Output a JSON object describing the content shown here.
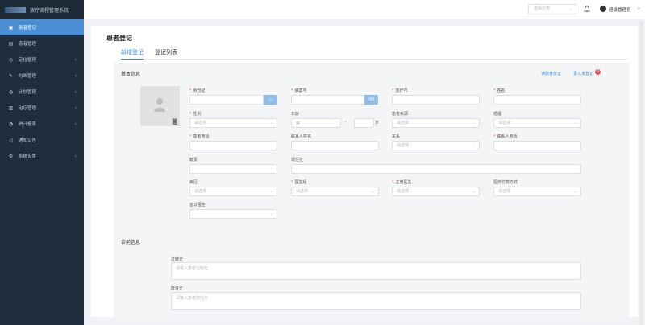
{
  "app": {
    "title": "放疗流程管理系统"
  },
  "sidebar": {
    "items": [
      {
        "label": "患者登记",
        "icon": "register-icon",
        "active": true,
        "has_children": false
      },
      {
        "label": "患者管理",
        "icon": "patient-list-icon",
        "active": false,
        "has_children": false
      },
      {
        "label": "定位管理",
        "icon": "locate-icon",
        "active": false,
        "has_children": true
      },
      {
        "label": "勾画管理",
        "icon": "draw-icon",
        "active": false,
        "has_children": true
      },
      {
        "label": "计划管理",
        "icon": "plan-icon",
        "active": false,
        "has_children": true
      },
      {
        "label": "治疗管理",
        "icon": "treatment-icon",
        "active": false,
        "has_children": true
      },
      {
        "label": "统计报表",
        "icon": "stats-icon",
        "active": false,
        "has_children": true
      },
      {
        "label": "通知公告",
        "icon": "notice-icon",
        "active": false,
        "has_children": false
      },
      {
        "label": "系统设置",
        "icon": "settings-icon",
        "active": false,
        "has_children": true
      }
    ]
  },
  "header": {
    "system_select_placeholder": "选择应用",
    "user_name": "超级管理员"
  },
  "page": {
    "title": "患者登记",
    "tabs": [
      "新增登记",
      "登记列表"
    ]
  },
  "basic": {
    "title": "基本信息",
    "read_id_card": "读取身份证",
    "unregistered": "录入未登记",
    "unregistered_count": "0",
    "id_card": "身份证",
    "case_no": "病案号",
    "case_btn": "HIS",
    "rt_no": "放疗号",
    "name": "姓名",
    "gender": "性别",
    "age": "年龄",
    "age_dash": "-",
    "age_unit": "岁",
    "source": "患者来源",
    "marital": "婚姻",
    "phone": "患者电话",
    "contact_name": "联系人姓名",
    "relation": "关系",
    "contact_phone": "联系人电话",
    "native": "籍贯",
    "address": "现住址",
    "ward": "病区",
    "doctor_group": "医生组",
    "chief_doctor": "主管医生",
    "payment": "医疗付款方式",
    "first_doctor": "首诊医生",
    "select_placeholder": "请选择"
  },
  "diagnosis": {
    "title": "诊前信息",
    "allergy": "过敏史",
    "allergy_placeholder": "请输入患者过敏史",
    "history": "既往史",
    "history_placeholder": "请输入患者既往史"
  }
}
